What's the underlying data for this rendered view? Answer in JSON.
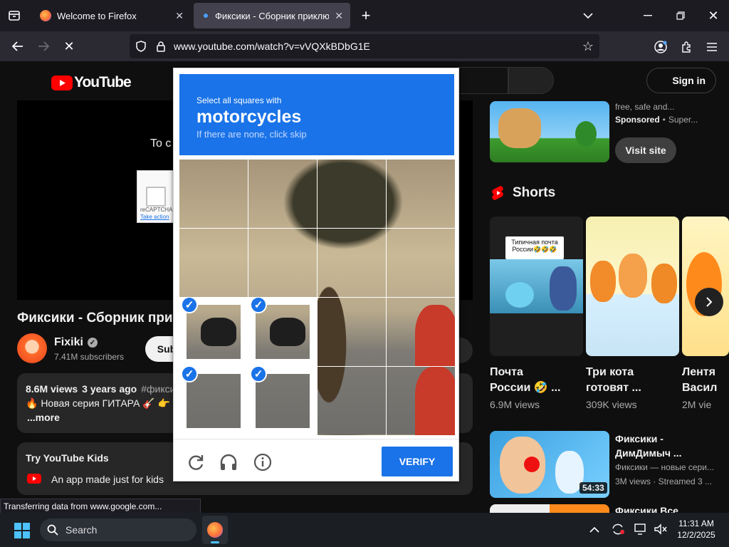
{
  "browser": {
    "tabs": [
      {
        "title": "Welcome to Firefox"
      },
      {
        "title": "Фиксики - Сборник приключе"
      }
    ],
    "url": "www.youtube.com/watch?v=vVQXkBDbG1E",
    "status_text": "Transferring data from www.google.com..."
  },
  "youtube": {
    "logo_text": "YouTube",
    "sign_in": "Sign in",
    "video_overlay_text": "To c",
    "recaptcha_label": "reCAPTCHA",
    "recaptcha_link": "Take action",
    "video_title": "Фиксики - Сборник при",
    "channel": {
      "name": "Fixiki",
      "subscribers": "7.41M subscribers",
      "subscribe": "Sub"
    },
    "description": {
      "views": "8.6M views",
      "date": "3 years ago",
      "hashtag": "#фикси",
      "line2": "🔥 Новая серия ГИТАРА 🎸 👉",
      "more": "...more"
    },
    "kids": {
      "title": "Try YouTube Kids",
      "text": "An app made just for kids"
    },
    "ad": {
      "line1": "free, safe and...",
      "sponsored": "Sponsored",
      "advertiser": "Super...",
      "visit": "Visit site"
    },
    "shorts_heading": "Shorts",
    "shorts": [
      {
        "overlay": "Типичная почта России🤣🤣🤣",
        "title1": "Почта",
        "title2": "России 🤣 ...",
        "views": "6.9M views"
      },
      {
        "overlay": "",
        "title1": "Три кота",
        "title2": "готовят ...",
        "views": "309K views"
      },
      {
        "overlay": "",
        "title1": "Лентя",
        "title2": "Васил",
        "views": "2M vie"
      }
    ],
    "rec": [
      {
        "title1": "Фиксики -",
        "title2": "ДимДимыч ...",
        "channel": "Фиксики — новые сери...",
        "meta": "3M views · Streamed 3 ...",
        "duration": "54:33"
      },
      {
        "title1": "Фиксики Все",
        "title2": "",
        "channel": "",
        "meta": "",
        "duration": ""
      }
    ]
  },
  "captcha": {
    "instruction": "Select all squares with",
    "target": "motorcycles",
    "hint": "If there are none, click skip",
    "verify": "VERIFY",
    "selected_cells": [
      8,
      9,
      12,
      13
    ]
  },
  "taskbar": {
    "search": "Search",
    "time": "11:31 AM",
    "date": "12/2/2025"
  },
  "colors": {
    "accent": "#1a73e8",
    "youtube_red": "#ff0000"
  }
}
